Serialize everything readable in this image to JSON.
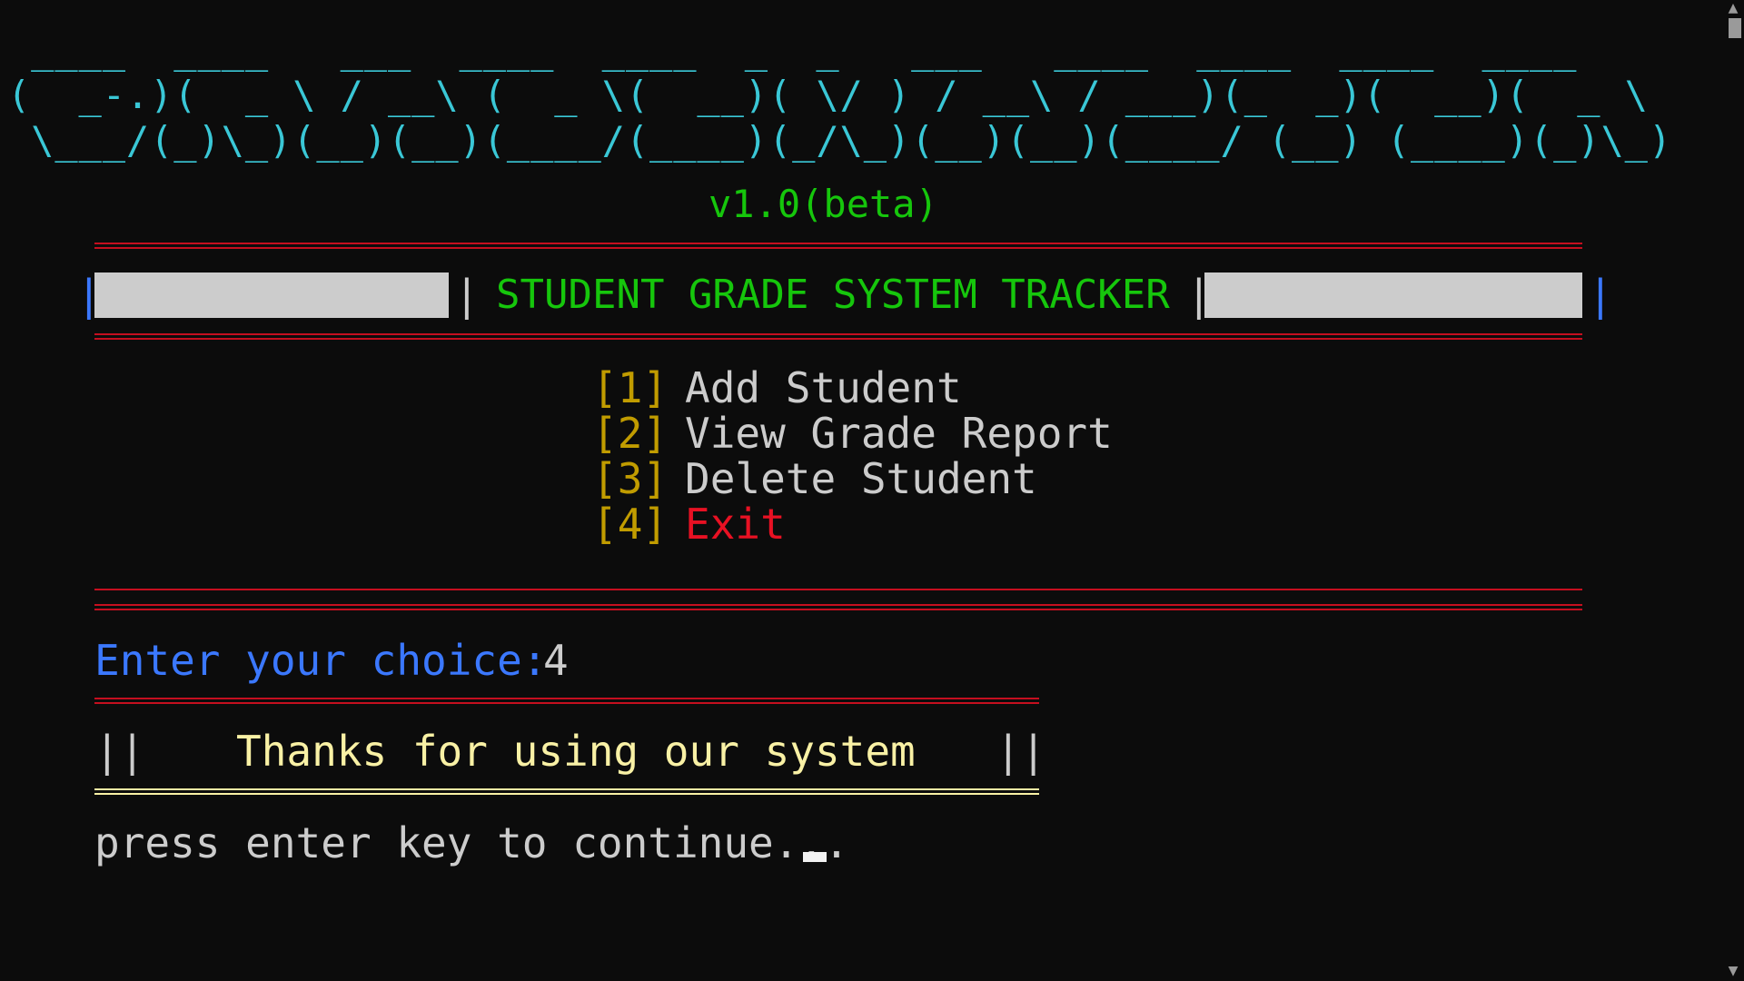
{
  "banner": {
    "line1": " ____  ____   ___  ____  ____  _  _   ___   ____  ____  ____  ____ ",
    "line2": "(  _-.)(  _ \\ / __\\ (  _ \\(  __)( \\/ ) / __\\ / ___)(_  _)(  __)(  _ \\",
    "line3": " \\___/(_)\\_)(__)(__)(____/(____)(_/\\_)(__)(__)(____/ (__) (____)(_)\\_)",
    "version": "v1.0(beta)"
  },
  "header": {
    "title": "STUDENT GRADE SYSTEM TRACKER",
    "bar": "|"
  },
  "menu": [
    {
      "key": "[1]",
      "label": "Add Student"
    },
    {
      "key": "[2]",
      "label": "View Grade Report"
    },
    {
      "key": "[3]",
      "label": "Delete Student"
    },
    {
      "key": "[4]",
      "label": "Exit"
    }
  ],
  "prompt": {
    "label": "Enter your choice:",
    "value": "4"
  },
  "thanks": {
    "left": "||",
    "text": "Thanks for using our system",
    "right": "||"
  },
  "continue_text": "press enter key to continue...",
  "scrollbar": {
    "up_icon": "▲",
    "down_icon": "▼"
  },
  "colors": {
    "background": "#0c0c0c",
    "banner": "#3ac7d6",
    "green": "#16c60c",
    "red": "#c50f1f",
    "gold": "#c19c00",
    "blue": "#3b78ff",
    "yellow": "#f9f1a5",
    "gray": "#cccccc"
  }
}
